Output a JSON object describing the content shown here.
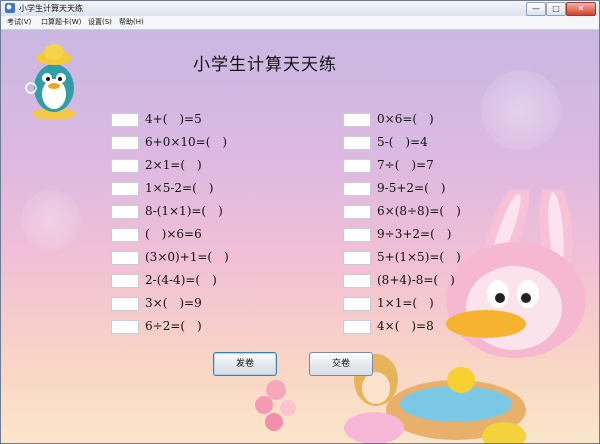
{
  "window": {
    "title": "小学生计算天天练"
  },
  "titlebar_buttons": {
    "minimize": "—",
    "maximize": "□",
    "close": "✕"
  },
  "menu": [
    {
      "label": "考试(V)"
    },
    {
      "label": "口算题卡(W)"
    },
    {
      "label": "设置(S)"
    },
    {
      "label": "帮助(H)"
    }
  ],
  "app_title": "小学生计算天天练",
  "questions_left": [
    "4+(　)=5",
    "6+0×10=(　)",
    "2×1=(　)",
    "1×5-2=(　)",
    "8-(1×1)=(　)",
    "(　)×6=6",
    "(3×0)+1=(　)",
    "2-(4-4)=(　)",
    "3×(　)=9",
    "6÷2=(　)"
  ],
  "questions_right": [
    "0×6=(　)",
    "5-(　)=4",
    "7÷(　)=7",
    "9-5+2=(　)",
    "6×(8÷8)=(　)",
    "9÷3+2=(　)",
    "5+(1×5)=(　)",
    "(8+4)-8=(　)",
    "1×1=(　)",
    "4×(　)=8"
  ],
  "buttons": {
    "send": "发卷",
    "submit": "交卷"
  },
  "colors": {
    "accent_blue": "#3c7fb1",
    "close_red": "#d3412a"
  }
}
